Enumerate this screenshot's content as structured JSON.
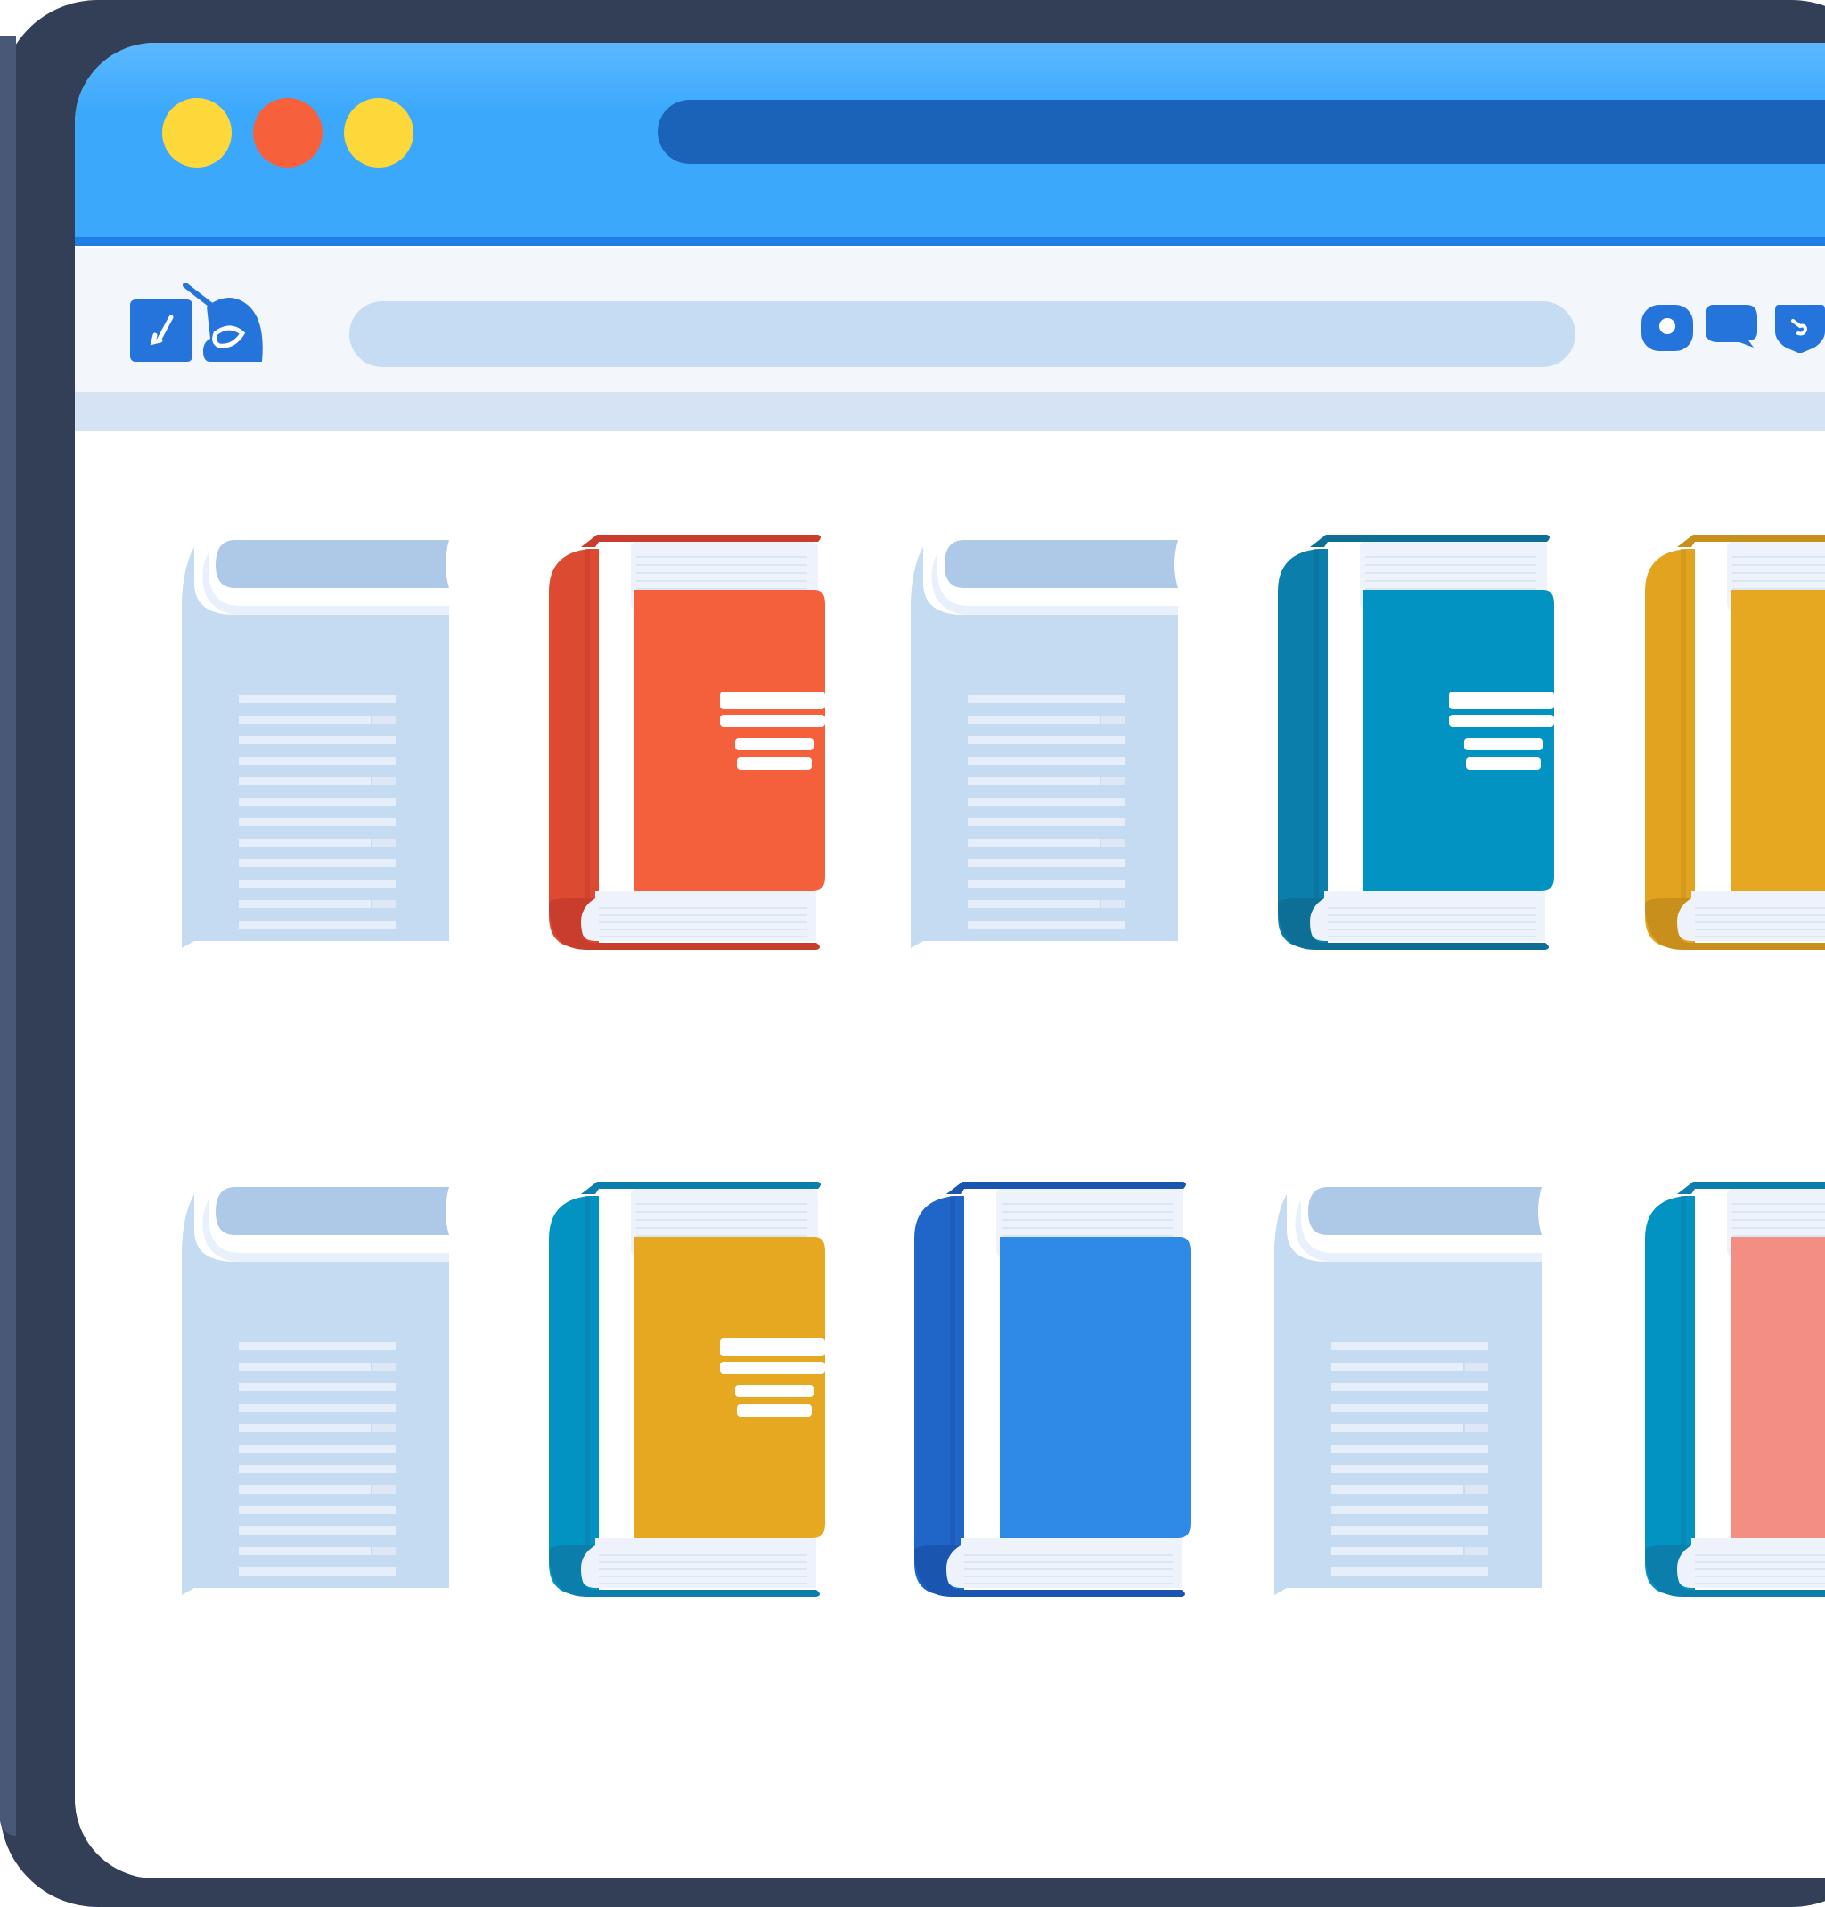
{
  "window": {
    "controls": [
      {
        "name": "window-dot-yellow-left",
        "color": "#fdd83a"
      },
      {
        "name": "window-dot-red",
        "color": "#f6603a"
      },
      {
        "name": "window-dot-yellow-right",
        "color": "#fdd83a"
      }
    ],
    "address_bar": {
      "value": ""
    }
  },
  "toolbar": {
    "logo_icon": "book-logo-icon",
    "search": {
      "value": "",
      "placeholder": ""
    },
    "icons": [
      "user-icon",
      "chat-bubble-icon",
      "shield-icon"
    ]
  },
  "library": {
    "rows": [
      [
        {
          "kind": "placeholder",
          "icon": "document-placeholder-icon"
        },
        {
          "kind": "book",
          "cover": "#f3603b",
          "spine": "#dd4a32",
          "trim": "#c83d2c",
          "title_lines": 4
        },
        {
          "kind": "placeholder",
          "icon": "document-placeholder-icon"
        },
        {
          "kind": "book",
          "cover": "#0293c2",
          "spine": "#0b7eab",
          "trim": "#0d6f95",
          "title_lines": 4
        },
        {
          "kind": "book",
          "cover": "#e6a820",
          "spine": "#e2a41f",
          "trim": "#c88f1c",
          "title_lines": 0
        }
      ],
      [
        {
          "kind": "placeholder",
          "icon": "document-placeholder-icon"
        },
        {
          "kind": "book",
          "cover": "#e6a820",
          "spine": "#0293c2",
          "trim": "#0b7eab",
          "title_lines": 4
        },
        {
          "kind": "book",
          "cover": "#2e8ae6",
          "spine": "#1f66c8",
          "trim": "#1a56b0",
          "title_lines": 0
        },
        {
          "kind": "placeholder",
          "icon": "document-placeholder-icon"
        },
        {
          "kind": "book",
          "cover": "#f28f82",
          "spine": "#0293c2",
          "trim": "#0b7eab",
          "title_lines": 0
        }
      ]
    ]
  }
}
